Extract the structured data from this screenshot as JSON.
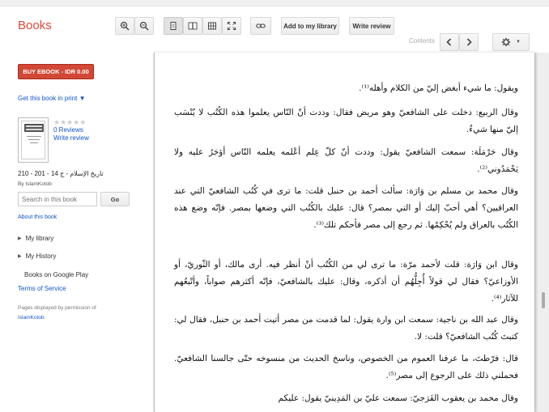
{
  "header": {
    "logo": "Books",
    "add_to_library": "Add to my library",
    "write_review": "Write review",
    "contents_label": "Contents"
  },
  "sidebar": {
    "buy_label": "BUY EBOOK - IDR 0.00",
    "get_in_print": "Get this book in print ▼",
    "reviews_count": "0 Reviews",
    "write_review": "Write review",
    "book_title": "تاريخ الإسلام - ج 14 - 201 - 210",
    "author": "By IslamKotob",
    "search_placeholder": "Search in this book",
    "go_label": "Go",
    "about_book": "About this book",
    "my_library": "My library",
    "my_history": "My History",
    "books_on_play": "Books on Google Play",
    "terms": "Terms of Service",
    "permission_text": "Pages displayed by permission of",
    "publisher": "IslamKotob",
    "publisher_suffix": "."
  },
  "page": {
    "paragraphs": [
      "ويقول: ما شيء أبغض إليّ من الكلام وأهله⁽¹⁾.",
      "وقال الربيع: دخلت على الشافعيّ وهو مريض فقال: وددت أنّ النّاس يعلموا هذه الكُتُب لا يُنْسَب إليّ منها شيءٌ.",
      "وقال حَرْمَلَة: سمعت الشافعيّ يقول: وددت أنّ كلّ عِلم أعْلمه يعلمه النّاس أؤجَرُ عليه ولا يَحْمَدُوني⁽²⁾.",
      "وقال محمد بن مسلم بن وَارَة: سألت أحمد بن حنبل قلت: ما ترى في كُتُب الشافعيّ التي عند العراقيين؟ أهي أحبّ إليك أو التي بمصر؟ قال: عليك بالكُتُب التي وضعها بمصر. فإنّه وضع هذه الكُتُب بالعراق ولم يُحْكِمْها. ثم رجع إلى مصر فأحكم تلك⁽³⁾.",
      "وقال ابن وَارَة: قلت لأحمد مرّة: ما ترى لي من الكُتُب أنْ أنظر فيه. أرى مالك، أو الثّوريّ، أو الأوزاعيّ؟ فقال لي قولاً أُجِلُّهُم أن أذكره، وقال: عليك بالشافعيّ، فإنّه أكثرهم صواباً، وأتْبعُهم للآثار⁽⁴⁾.",
      "وقال عبد الله بن ناجية: سمعت ابن وارة يقول: لما قدمت من مصر أتيت أحمد بن حنبل، فقال لي: كتبتَ كُتُب الشافعيّ؟ قلت: لا.",
      "قال: فرّطتَ، ما عرفنا العموم من الخصوص، وناسخ الحديث من منسوخه حتّى جالسنا الشافعيّ. فحملني ذلك على الرجوع إلى مصر⁽⁵⁾.",
      "وقال محمد بن يعقوب الفَرَجيّ: سمعت عليّ بن المَدِينيّ يقول: عليكم"
    ]
  }
}
